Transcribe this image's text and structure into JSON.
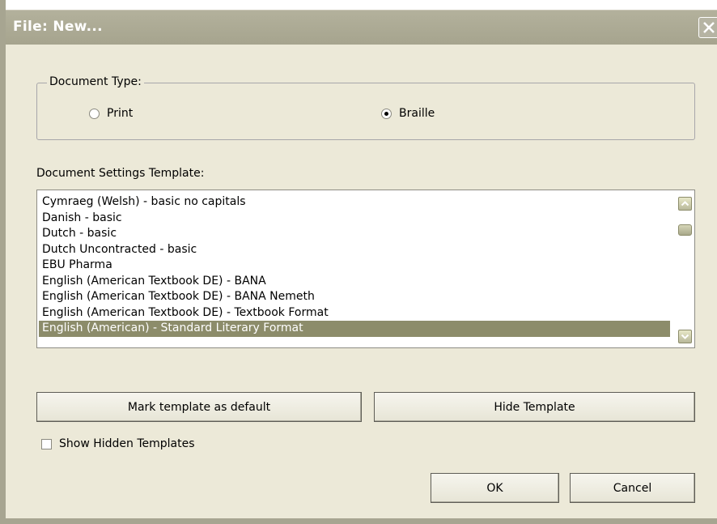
{
  "dialog": {
    "title": "File: New...",
    "close_glyph": "close-icon"
  },
  "document_type": {
    "legend": "Document Type:",
    "options": [
      {
        "label": "Print",
        "selected": false
      },
      {
        "label": "Braille",
        "selected": true
      }
    ]
  },
  "template_section": {
    "label": "Document Settings Template:",
    "items": [
      "Cymraeg (Welsh) - basic no capitals",
      "Danish - basic",
      "Dutch - basic",
      "Dutch Uncontracted - basic",
      "EBU Pharma",
      "English (American Textbook DE) - BANA",
      "English (American Textbook DE) - BANA Nemeth",
      "English (American Textbook DE) - Textbook Format",
      "English (American) - Standard Literary Format"
    ],
    "selected_index": 8
  },
  "buttons": {
    "mark_default": "Mark template as default",
    "hide_template": "Hide Template",
    "ok": "OK",
    "cancel": "Cancel"
  },
  "show_hidden": {
    "label": "Show Hidden Templates",
    "checked": false
  },
  "colors": {
    "background": "#ece9d8",
    "titlebar": "#a6a48e",
    "selection": "#8c8c6a"
  }
}
